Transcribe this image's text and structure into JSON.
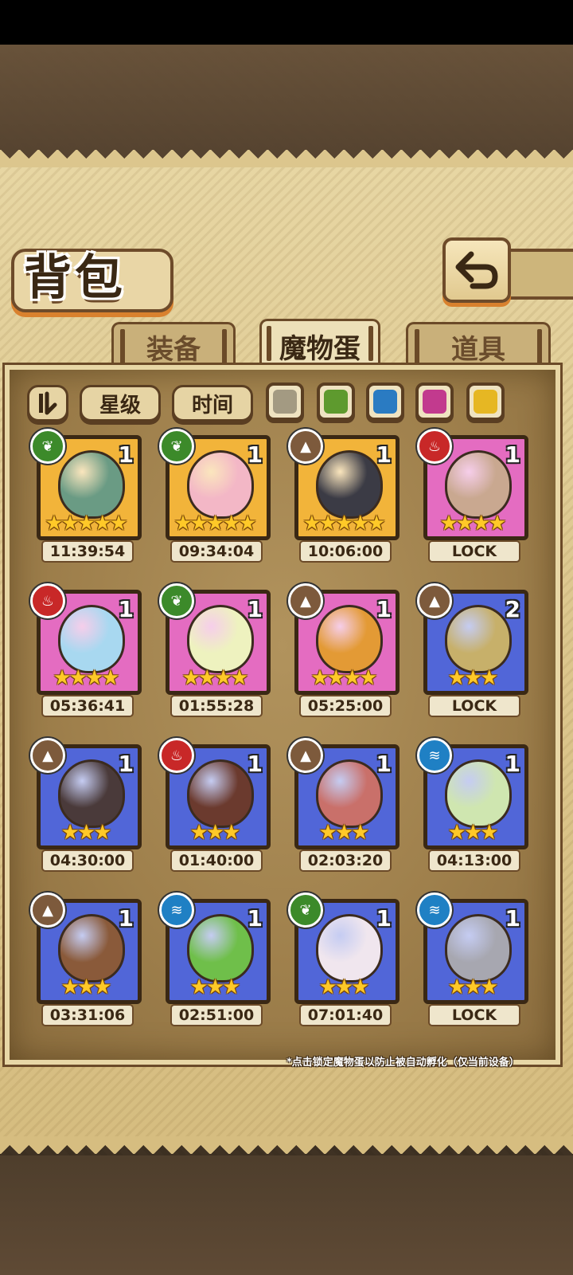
{
  "title": "背包",
  "tabs": [
    {
      "label": "装备",
      "active": false
    },
    {
      "label": "魔物蛋",
      "active": true
    },
    {
      "label": "道具",
      "active": false
    }
  ],
  "filters": {
    "sort_star": "星级",
    "sort_time": "时间"
  },
  "color_filters": [
    "#a39a82",
    "#5e9a2e",
    "#2a7bc2",
    "#c23a8e",
    "#e6b723"
  ],
  "rarity_colors": {
    "gold": "#f2b43a",
    "pink": "#e46cc1",
    "blue": "#5166d8"
  },
  "element_icons": {
    "leaf": {
      "icon": "leaf-icon",
      "color": "#3c8a2a"
    },
    "earth": {
      "icon": "mountain-icon",
      "color": "#7d5a3c"
    },
    "fire": {
      "icon": "flame-icon",
      "color": "#c82828"
    },
    "water": {
      "icon": "water-wave-icon",
      "color": "#1f80c4"
    }
  },
  "eggs": [
    {
      "element": "leaf",
      "rarity": "gold",
      "count": "1",
      "stars": 5,
      "timer": "11:39:54",
      "color": "#6a9b84"
    },
    {
      "element": "leaf",
      "rarity": "gold",
      "count": "1",
      "stars": 5,
      "timer": "09:34:04",
      "color": "#f3b7c6"
    },
    {
      "element": "earth",
      "rarity": "gold",
      "count": "1",
      "stars": 5,
      "timer": "10:06:00",
      "color": "#3b3b45"
    },
    {
      "element": "fire",
      "rarity": "pink",
      "count": "1",
      "stars": 4,
      "timer": "LOCK",
      "color": "#c9a890"
    },
    {
      "element": "fire",
      "rarity": "pink",
      "count": "1",
      "stars": 4,
      "timer": "05:36:41",
      "color": "#a8d8f0"
    },
    {
      "element": "leaf",
      "rarity": "pink",
      "count": "1",
      "stars": 4,
      "timer": "01:55:28",
      "color": "#eef2bf"
    },
    {
      "element": "earth",
      "rarity": "pink",
      "count": "1",
      "stars": 4,
      "timer": "05:25:00",
      "color": "#e39a35"
    },
    {
      "element": "earth",
      "rarity": "blue",
      "count": "2",
      "stars": 3,
      "timer": "LOCK",
      "color": "#c7b06a"
    },
    {
      "element": "earth",
      "rarity": "blue",
      "count": "1",
      "stars": 3,
      "timer": "04:30:00",
      "color": "#4a3a3a"
    },
    {
      "element": "fire",
      "rarity": "blue",
      "count": "1",
      "stars": 3,
      "timer": "01:40:00",
      "color": "#6b3a2e"
    },
    {
      "element": "earth",
      "rarity": "blue",
      "count": "1",
      "stars": 3,
      "timer": "02:03:20",
      "color": "#c9706a"
    },
    {
      "element": "water",
      "rarity": "blue",
      "count": "1",
      "stars": 3,
      "timer": "04:13:00",
      "color": "#cfe6b0"
    },
    {
      "element": "earth",
      "rarity": "blue",
      "count": "1",
      "stars": 3,
      "timer": "03:31:06",
      "color": "#8a5a3a"
    },
    {
      "element": "water",
      "rarity": "blue",
      "count": "1",
      "stars": 3,
      "timer": "02:51:00",
      "color": "#6fbf4a"
    },
    {
      "element": "leaf",
      "rarity": "blue",
      "count": "1",
      "stars": 3,
      "timer": "07:01:40",
      "color": "#f0e6ee"
    },
    {
      "element": "water",
      "rarity": "blue",
      "count": "1",
      "stars": 3,
      "timer": "LOCK",
      "color": "#a7a7b0"
    }
  ],
  "hint": "*点击锁定魔物蛋以防止被自动孵化（仅当前设备）"
}
